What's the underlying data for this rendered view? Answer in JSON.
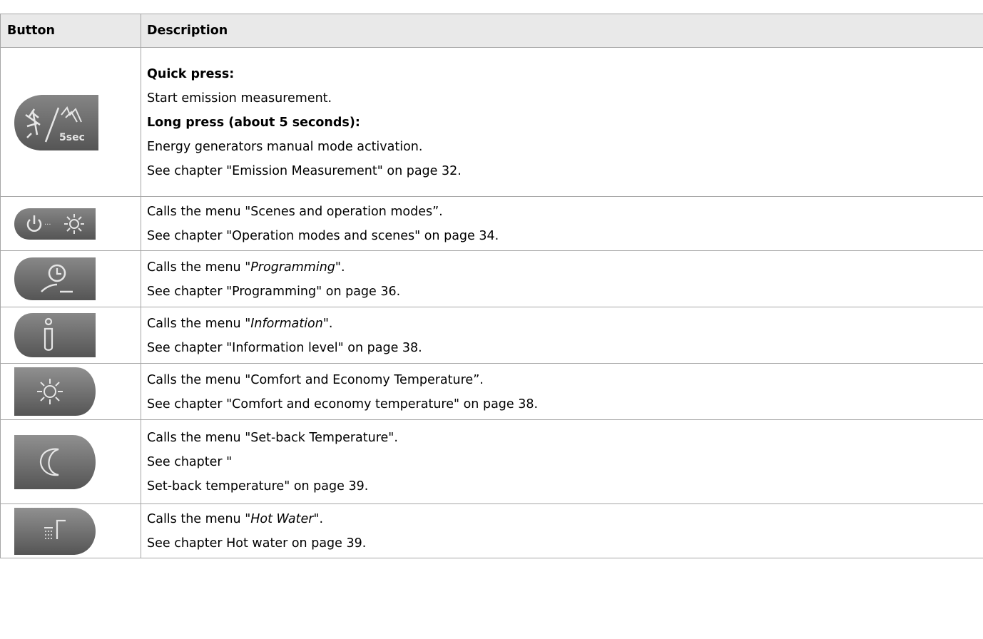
{
  "table": {
    "headers": {
      "button": "Button",
      "description": "Description"
    },
    "rows": [
      {
        "icon": "emission-measurement-5sec-button-icon",
        "icon_text": "5sec",
        "lines": [
          {
            "text": "Quick press:"
          },
          {
            "text": "Start emission measurement."
          },
          {
            "text": "Long press (about 5 seconds):"
          },
          {
            "text": "Energy generators manual mode activation."
          },
          {
            "text": "See chapter \"Emission Measurement\" on page 32."
          }
        ]
      },
      {
        "icon": "power-scenes-button-icon",
        "lines": [
          {
            "text": "Calls the menu \"Scenes and operation modes”."
          },
          {
            "text": "See chapter \"Operation modes and scenes\" on page 34."
          }
        ]
      },
      {
        "icon": "clock-programming-button-icon",
        "lines": [
          {
            "pre": "Calls the menu \"",
            "em": "Programming",
            "post": "\"."
          },
          {
            "text": "See chapter \"Programming\" on page 36."
          }
        ]
      },
      {
        "icon": "info-button-icon",
        "lines": [
          {
            "pre": "Calls the menu \"",
            "em": "Information",
            "post": "\"."
          },
          {
            "text": "See chapter \"Information level\" on page 38."
          }
        ]
      },
      {
        "icon": "sun-comfort-button-icon",
        "lines": [
          {
            "text": "Calls the menu \"Comfort and Economy Temperature”."
          },
          {
            "text": "See chapter \"Comfort and economy temperature\" on page 38."
          }
        ]
      },
      {
        "icon": "moon-setback-button-icon",
        "lines": [
          {
            "text": "Calls the menu \"Set-back Temperature\"."
          },
          {
            "text": "See chapter \""
          },
          {
            "text": "Set-back temperature\" on page 39."
          }
        ]
      },
      {
        "icon": "shower-hot-water-button-icon",
        "lines": [
          {
            "pre": "Calls the menu \"",
            "em": "Hot Water",
            "post": "\"."
          },
          {
            "text": "See chapter Hot water  on page 39."
          }
        ]
      }
    ]
  },
  "colors": {
    "header_bg": "#e9e9e9",
    "border": "#a6a6a6",
    "button_body": "#6b6b6b",
    "button_symbol": "#e6e6e6"
  }
}
